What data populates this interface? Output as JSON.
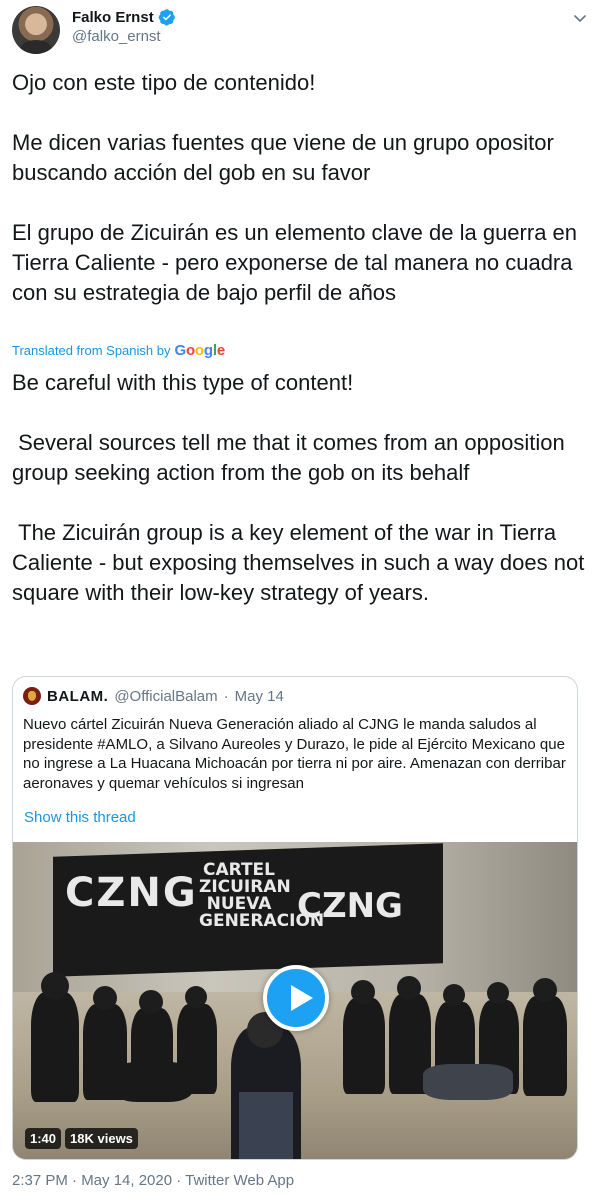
{
  "author": {
    "name": "Falko Ernst",
    "handle": "@falko_ernst"
  },
  "tweet": {
    "original_text": "Ojo con este tipo de contenido!\n\nMe dicen varias fuentes que viene de un grupo opositor buscando acción del gob en su favor\n\nEl grupo de Zicuirán es un elemento clave de la guerra en Tierra Caliente - pero exponerse de tal manera no cuadra con su estrategia de bajo perfil de años",
    "translated_label": "Translated from Spanish by",
    "translator_brand": [
      "G",
      "o",
      "o",
      "g",
      "l",
      "e"
    ],
    "translated_text": "Be careful with this type of content!\n\n Several sources tell me that it comes from an opposition group seeking action from the gob on its behalf\n\n The Zicuirán group is a key element of the war in Tierra Caliente - but exposing themselves in such a way does not square with their low-key strategy of years.",
    "timestamp": "2:37 PM · May 14, 2020 · Twitter Web App"
  },
  "quoted_tweet": {
    "name": "BALAM.",
    "handle": "@OfficialBalam",
    "separator": "·",
    "date": "May 14",
    "text": "Nuevo cártel Zicuirán Nueva Generación aliado al CJNG le manda saludos al presidente #AMLO, a Silvano Aureoles y Durazo, le pide al Ejército Mexicano que no ingrese a La Huacana Michoacán por tierra ni por aire. Amenazan con derribar aeronaves y quemar  vehículos si ingresan",
    "show_thread": "Show this thread",
    "video": {
      "duration": "1:40",
      "views": "18K views",
      "banner_left": "CZNG",
      "banner_center": "CARTEL ZICUIRAN NUEVA GENERACIÓN",
      "banner_right": "CZNG"
    }
  },
  "colors": {
    "accent": "#1da1f2",
    "link": "#1b95e0",
    "secondary_text": "#657786"
  },
  "icons": {
    "verified": "verified-badge-icon",
    "menu": "chevron-down-icon",
    "play": "play-icon"
  }
}
